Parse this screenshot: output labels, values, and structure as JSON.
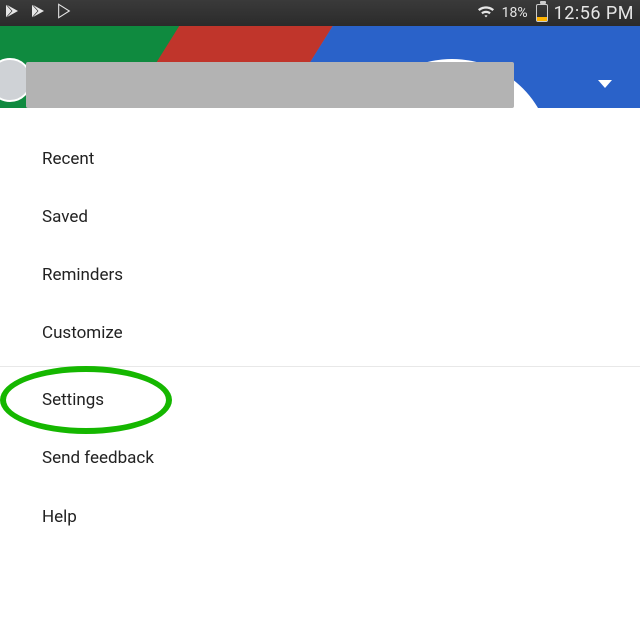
{
  "statusbar": {
    "battery_pct": "18%",
    "clock": "12:56 PM"
  },
  "menu": {
    "items": [
      {
        "label": "Recent"
      },
      {
        "label": "Saved"
      },
      {
        "label": "Reminders"
      },
      {
        "label": "Customize"
      },
      {
        "label": "Settings"
      },
      {
        "label": "Send feedback"
      },
      {
        "label": "Help"
      }
    ],
    "divider_after_index": 3,
    "highlighted_index": 4
  },
  "colors": {
    "highlight": "#15b700",
    "google_green": "#0f8a3f",
    "google_red": "#c0352b",
    "google_blue": "#2a62c9"
  }
}
